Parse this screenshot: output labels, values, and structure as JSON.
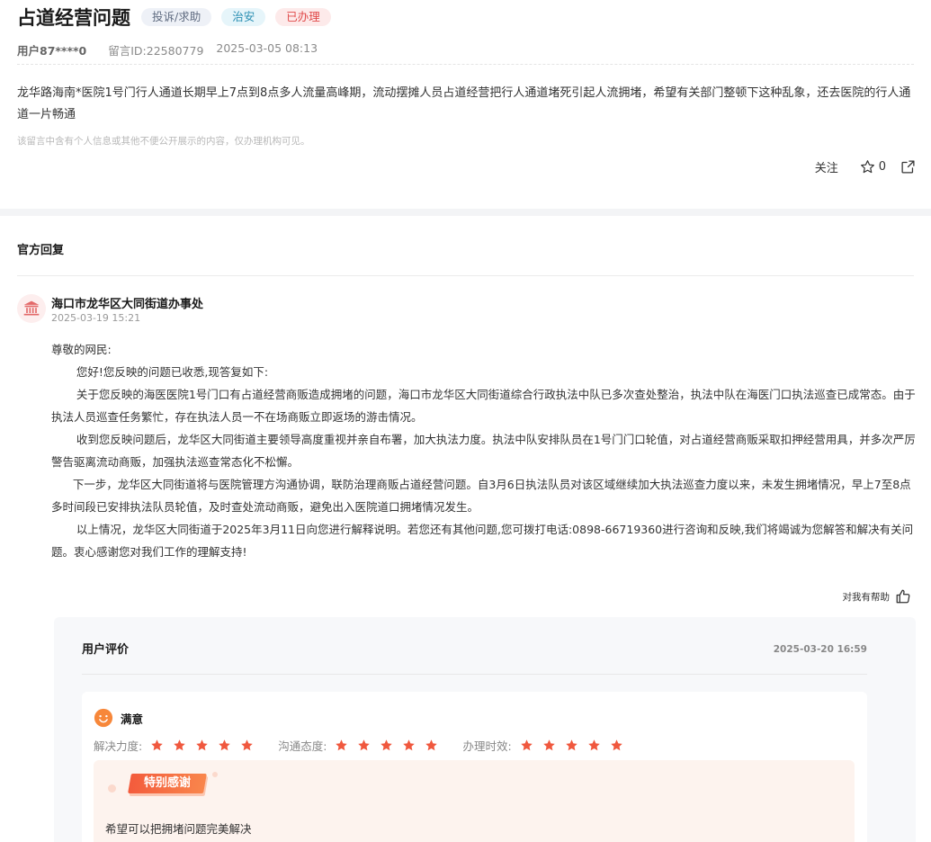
{
  "header": {
    "title": "占道经营问题",
    "tags": [
      "投诉/求助",
      "治安",
      "已办理"
    ],
    "user": "用户87****0",
    "message_id": "留言ID:22580779",
    "datetime": "2025-03-05 08:13"
  },
  "message": {
    "content": "龙华路海南*医院1号门行人通道长期早上7点到8点多人流量高峰期，流动摆摊人员占道经营把行人通道堵死引起人流拥堵，希望有关部门整顿下这种乱象，还去医院的行人通道一片畅通",
    "notice": "该留言中含有个人信息或其他不便公开展示的内容，仅办理机构可见。"
  },
  "actions": {
    "follow_label": "关注",
    "star_count": "0",
    "icons": [
      "star-icon",
      "share-icon"
    ]
  },
  "reply": {
    "section_title": "官方回复",
    "org_name": "海口市龙华区大同街道办事处",
    "org_date": "2025-03-19 15:21",
    "paragraphs": [
      "尊敬的网民:",
      "       您好!您反映的问题已收悉,现答复如下:",
      "       关于您反映的海医医院1号门口有占道经营商贩造成拥堵的问题，海口市龙华区大同街道综合行政执法中队已多次查处整治，执法中队在海医门口执法巡查已成常态。由于执法人员巡查任务繁忙，存在执法人员一不在场商贩立即返场的游击情况。",
      "       收到您反映问题后，龙华区大同街道主要领导高度重视并亲自布署，加大执法力度。执法中队安排队员在1号门门口轮值，对占道经营商贩采取扣押经营用具，并多次严厉警告驱离流动商贩，加强执法巡查常态化不松懈。",
      "      下一步，龙华区大同街道将与医院管理方沟通协调，联防治理商贩占道经营问题。自3月6日执法队员对该区域继续加大执法巡查力度以来，未发生拥堵情况，早上7至8点多时间段已安排执法队员轮值，及时查处流动商贩，避免出入医院道口拥堵情况发生。",
      "       以上情况，龙华区大同街道于2025年3月11日向您进行解释说明。若您还有其他问题,您可拨打电话:0898-66719360进行咨询和反映,我们将竭诚为您解答和解决有关问题。衷心感谢您对我们工作的理解支持!"
    ],
    "helpful_label": "对我有帮助"
  },
  "evaluation": {
    "title": "用户评价",
    "date": "2025-03-20 16:59",
    "satisfaction": "满意",
    "ratings": [
      {
        "label": "解决力度:",
        "stars": 5
      },
      {
        "label": "沟通态度:",
        "stars": 5
      },
      {
        "label": "办理时效:",
        "stars": 5
      }
    ],
    "thanks_badge": "特别感谢",
    "thanks_text": "希望可以把拥堵问题完美解决"
  },
  "colors": {
    "accent_red": "#e04a4a",
    "star_red": "#f0583e"
  }
}
